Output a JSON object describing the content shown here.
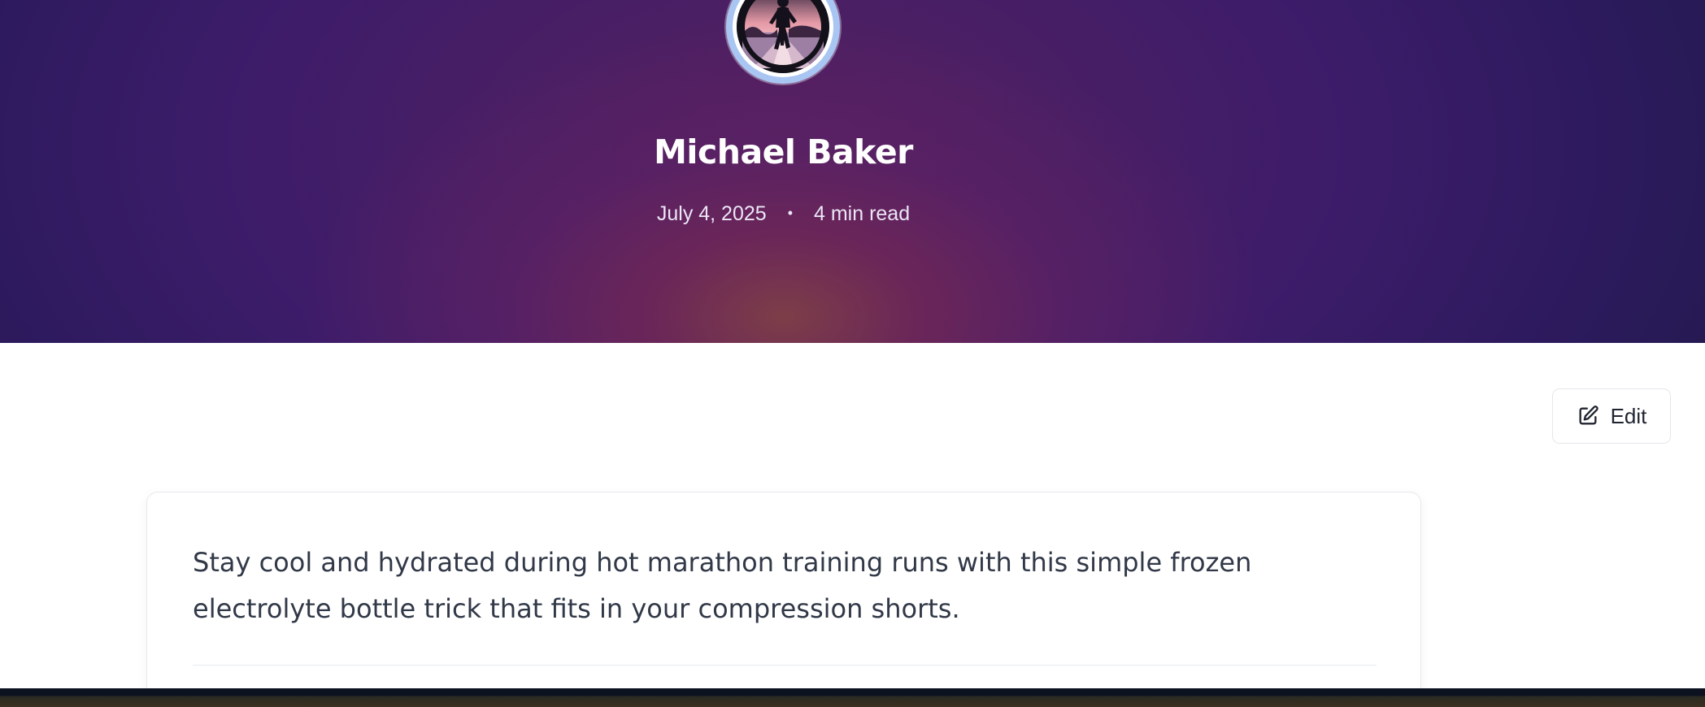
{
  "author": {
    "name": "Michael Baker",
    "avatar_icon": "runner-avatar-icon"
  },
  "meta": {
    "date": "July 4, 2025",
    "separator": "•",
    "read_time": "4 min read"
  },
  "actions": {
    "edit_label": "Edit",
    "edit_icon": "edit-icon"
  },
  "article": {
    "summary": "Stay cool and hydrated during hot marathon training runs with this simple frozen electrolyte bottle trick that fits in your compression shorts."
  },
  "colors": {
    "hero_dark": "#1d1840",
    "hero_mid": "#55215f",
    "hero_glow": "#7d3e48",
    "avatar_ring": "#a9c6f2",
    "text_dark": "#313847"
  }
}
